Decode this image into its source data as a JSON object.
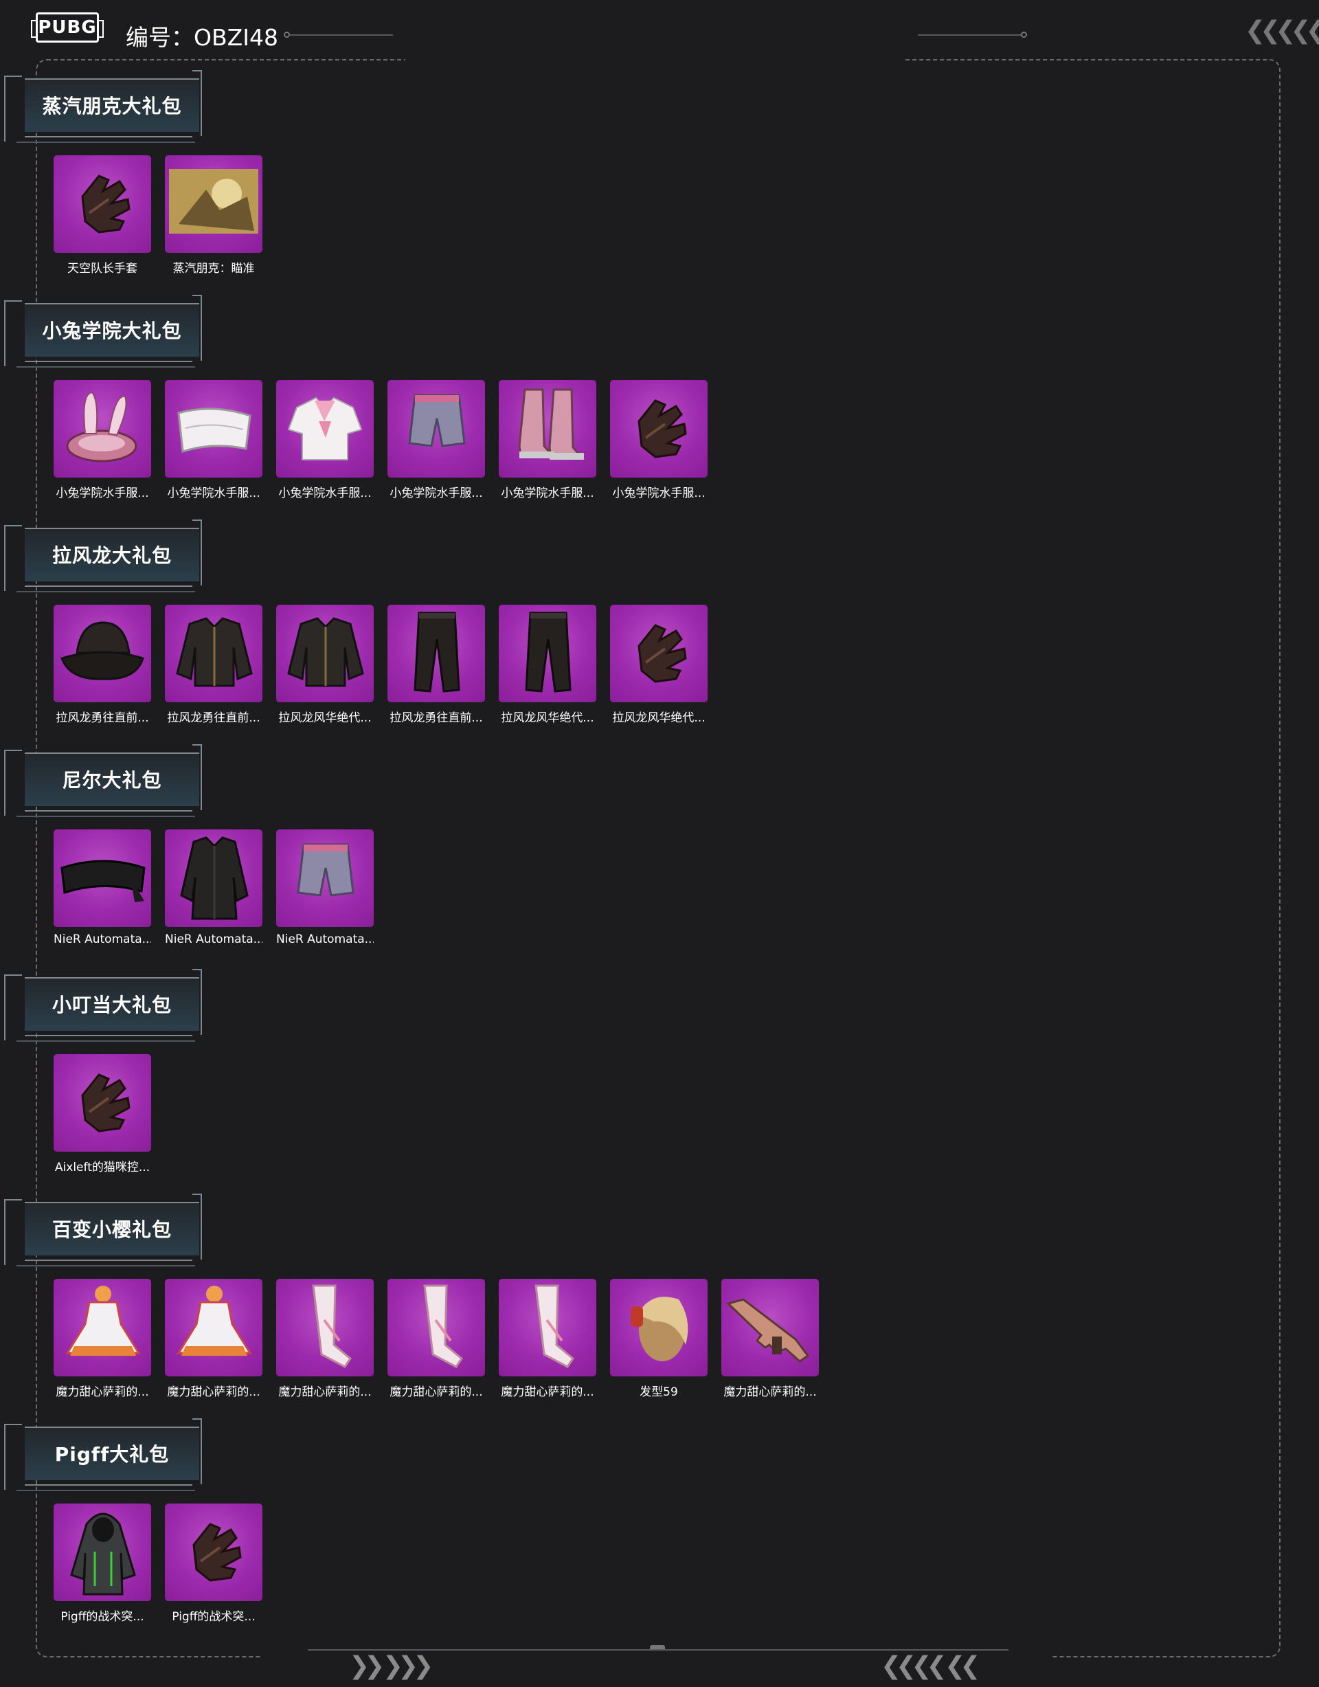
{
  "header": {
    "logo_text": "PUBG",
    "serial": "编号：OBZI48"
  },
  "sections": [
    {
      "title": "蒸汽朋克大礼包",
      "items": [
        {
          "caption": "天空队长手套",
          "icon": "glove-icon"
        },
        {
          "caption": "蒸汽朋克：瞄准",
          "icon": "emote-image-icon"
        }
      ]
    },
    {
      "title": "小兔学院大礼包",
      "items": [
        {
          "caption": "小兔学院水手服...",
          "icon": "bunny-hat-icon"
        },
        {
          "caption": "小兔学院水手服...",
          "icon": "mask-icon"
        },
        {
          "caption": "小兔学院水手服...",
          "icon": "shirt-icon"
        },
        {
          "caption": "小兔学院水手服...",
          "icon": "shorts-icon"
        },
        {
          "caption": "小兔学院水手服...",
          "icon": "boots-icon"
        },
        {
          "caption": "小兔学院水手服...",
          "icon": "glove-icon"
        }
      ]
    },
    {
      "title": "拉风龙大礼包",
      "items": [
        {
          "caption": "拉风龙勇往直前...",
          "icon": "bucket-hat-icon"
        },
        {
          "caption": "拉风龙勇往直前...",
          "icon": "jacket-icon"
        },
        {
          "caption": "拉风龙风华绝代...",
          "icon": "jacket-icon"
        },
        {
          "caption": "拉风龙勇往直前...",
          "icon": "pants-icon"
        },
        {
          "caption": "拉风龙风华绝代...",
          "icon": "pants-icon"
        },
        {
          "caption": "拉风龙风华绝代...",
          "icon": "glove-icon"
        }
      ]
    },
    {
      "title": "尼尔大礼包",
      "items": [
        {
          "caption": "NieR Automata...",
          "icon": "blindfold-icon"
        },
        {
          "caption": "NieR Automata...",
          "icon": "coat-icon"
        },
        {
          "caption": "NieR Automata...",
          "icon": "shorts-icon"
        }
      ]
    },
    {
      "title": "小叮当大礼包",
      "items": [
        {
          "caption": "Aixleft的猫咪控...",
          "icon": "glove-icon"
        }
      ]
    },
    {
      "title": "百变小樱礼包",
      "items": [
        {
          "caption": "魔力甜心萨莉的...",
          "icon": "dress-icon"
        },
        {
          "caption": "魔力甜心萨莉的...",
          "icon": "dress-icon"
        },
        {
          "caption": "魔力甜心萨莉的...",
          "icon": "stocking-icon"
        },
        {
          "caption": "魔力甜心萨莉的...",
          "icon": "stocking-icon"
        },
        {
          "caption": "魔力甜心萨莉的...",
          "icon": "stocking-icon"
        },
        {
          "caption": "发型59",
          "icon": "hairstyle-icon"
        },
        {
          "caption": "魔力甜心萨莉的...",
          "icon": "rifle-icon"
        }
      ]
    },
    {
      "title": "Pigff大礼包",
      "items": [
        {
          "caption": "Pigff的战术突...",
          "icon": "hoodie-icon"
        },
        {
          "caption": "Pigff的战术突...",
          "icon": "glove-icon"
        }
      ]
    }
  ]
}
